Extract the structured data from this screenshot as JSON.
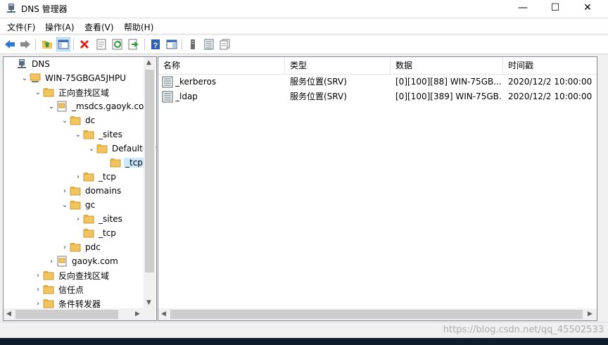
{
  "window": {
    "title": "DNS 管理器",
    "minimize": "—",
    "maximize": "☐",
    "close": "✕"
  },
  "menu": [
    "文件(F)",
    "操作(A)",
    "查看(V)",
    "帮助(H)"
  ],
  "tree": {
    "items": [
      {
        "label": "DNS",
        "icon": "dns-icon",
        "arrow": ""
      },
      {
        "label": "WIN-75GBGA5JHPU",
        "icon": "server-icon",
        "arrow": "⌄"
      },
      {
        "label": "正向查找区域",
        "icon": "folder-icon",
        "arrow": "⌄"
      },
      {
        "label": "_msdcs.gaoyk.com",
        "icon": "zone-icon",
        "arrow": "⌄"
      },
      {
        "label": "dc",
        "icon": "folder-icon",
        "arrow": "⌄"
      },
      {
        "label": "_sites",
        "icon": "folder-icon",
        "arrow": "⌄"
      },
      {
        "label": "Default-Firs",
        "icon": "folder-icon",
        "arrow": "⌄"
      },
      {
        "label": "_tcp",
        "icon": "folder-icon",
        "arrow": ""
      },
      {
        "label": "_tcp",
        "icon": "folder-icon",
        "arrow": "›"
      },
      {
        "label": "domains",
        "icon": "folder-icon",
        "arrow": "›"
      },
      {
        "label": "gc",
        "icon": "folder-icon",
        "arrow": "⌄"
      },
      {
        "label": "_sites",
        "icon": "folder-icon",
        "arrow": "›"
      },
      {
        "label": "_tcp",
        "icon": "folder-icon",
        "arrow": ""
      },
      {
        "label": "pdc",
        "icon": "folder-icon",
        "arrow": "›"
      },
      {
        "label": "gaoyk.com",
        "icon": "zone-icon",
        "arrow": "›"
      },
      {
        "label": "反向查找区域",
        "icon": "folder-icon",
        "arrow": "›"
      },
      {
        "label": "信任点",
        "icon": "folder-icon",
        "arrow": "›"
      },
      {
        "label": "条件转发器",
        "icon": "folder-icon",
        "arrow": "›"
      }
    ]
  },
  "list": {
    "columns": [
      "名称",
      "类型",
      "数据",
      "时间戳"
    ],
    "rows": [
      {
        "name": "_kerberos",
        "type": "服务位置(SRV)",
        "data": "[0][100][88] WIN-75GB...",
        "timestamp": "2020/12/2 10:00:00"
      },
      {
        "name": "_ldap",
        "type": "服务位置(SRV)",
        "data": "[0][100][389] WIN-75GB...",
        "timestamp": "2020/12/2 10:00:00"
      }
    ]
  },
  "watermark": "https://blog.csdn.net/qq_45502533",
  "colors": {
    "selection": "#cce8ff",
    "folder": "#f2c55c",
    "accent_blue": "#2f78d5"
  }
}
